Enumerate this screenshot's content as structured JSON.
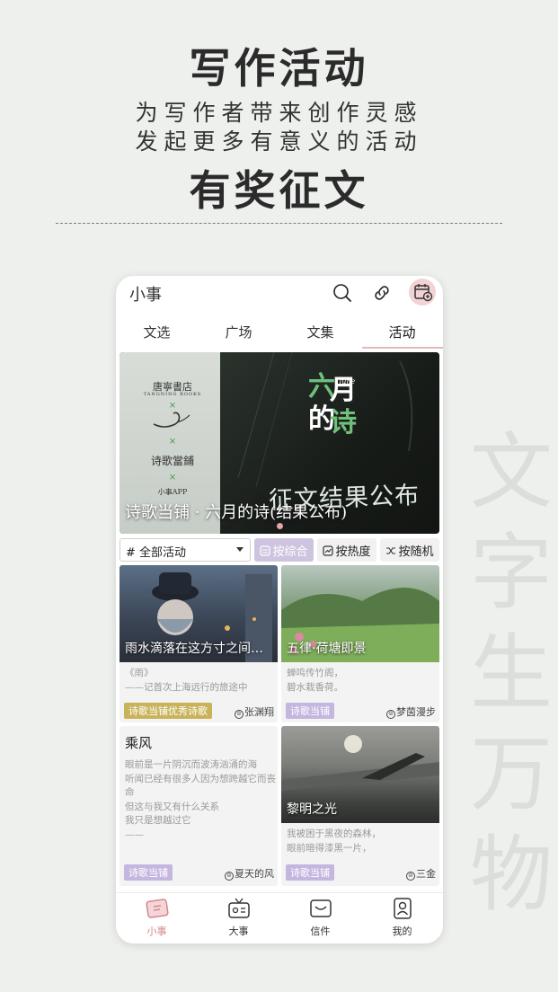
{
  "promo": {
    "title": "写作活动",
    "line1": "为写作者带来创作灵感",
    "line2": "发起更多有意义的活动",
    "title2": "有奖征文",
    "bg_deco": [
      "文",
      "字",
      "生",
      "万",
      "物"
    ]
  },
  "app": {
    "name": "小事",
    "icons": {
      "search": "search-icon",
      "link": "link-icon",
      "calendar": "calendar-add-icon"
    },
    "tabs": [
      "文选",
      "广场",
      "文集",
      "活动"
    ],
    "active_tab": "活动"
  },
  "banner": {
    "left_brand": "唐寧書店",
    "left_brand_sub": "TANGNING BOOKS",
    "left_mid": "诗歌當鋪",
    "left_app": "小事APP",
    "cross": "×",
    "june": "June",
    "month_chars": [
      "六",
      "月",
      "的",
      "诗"
    ],
    "cta": "征文结果公布",
    "caption": "诗歌当铺 · 六月的诗(结果公布)"
  },
  "filter": {
    "select_label": "# 全部活动",
    "sort_options": [
      "按综合",
      "按热度",
      "按随机"
    ],
    "active_sort": "按综合"
  },
  "cards": [
    {
      "image_title": "雨水滴落在这方寸之间…",
      "lines": "《雨》\n——记首次上海远行的旅途中",
      "tag": "诗歌当铺优秀诗歌",
      "author": "张渊翔"
    },
    {
      "image_title": "五律·荷塘即景",
      "lines": "蝉鸣传竹阁，\n碧水栽香荷。",
      "tag": "诗歌当铺",
      "author": "梦茵漫步"
    },
    {
      "title": "乘风",
      "lines": "眼前是一片阴沉而波涛汹涌的海\n听闻已经有很多人因为想跨越它而丧命\n但这与我又有什么关系\n我只是想越过它\n——",
      "tag": "诗歌当铺",
      "author": "夏天的风"
    },
    {
      "image_title": "黎明之光",
      "lines": "我被困于黑夜的森林，\n眼前暗得漆黑一片，",
      "tag": "诗歌当铺",
      "author": "三金"
    }
  ],
  "nav": [
    {
      "label": "小事",
      "icon": "home-doc-icon"
    },
    {
      "label": "大事",
      "icon": "radio-icon"
    },
    {
      "label": "信件",
      "icon": "mail-icon"
    },
    {
      "label": "我的",
      "icon": "profile-icon"
    }
  ],
  "colors": {
    "accent_pink": "#d5868e",
    "tag_gold": "#c9b35a",
    "tag_purple": "#c4b6df",
    "banner_green": "#6fc07a"
  }
}
